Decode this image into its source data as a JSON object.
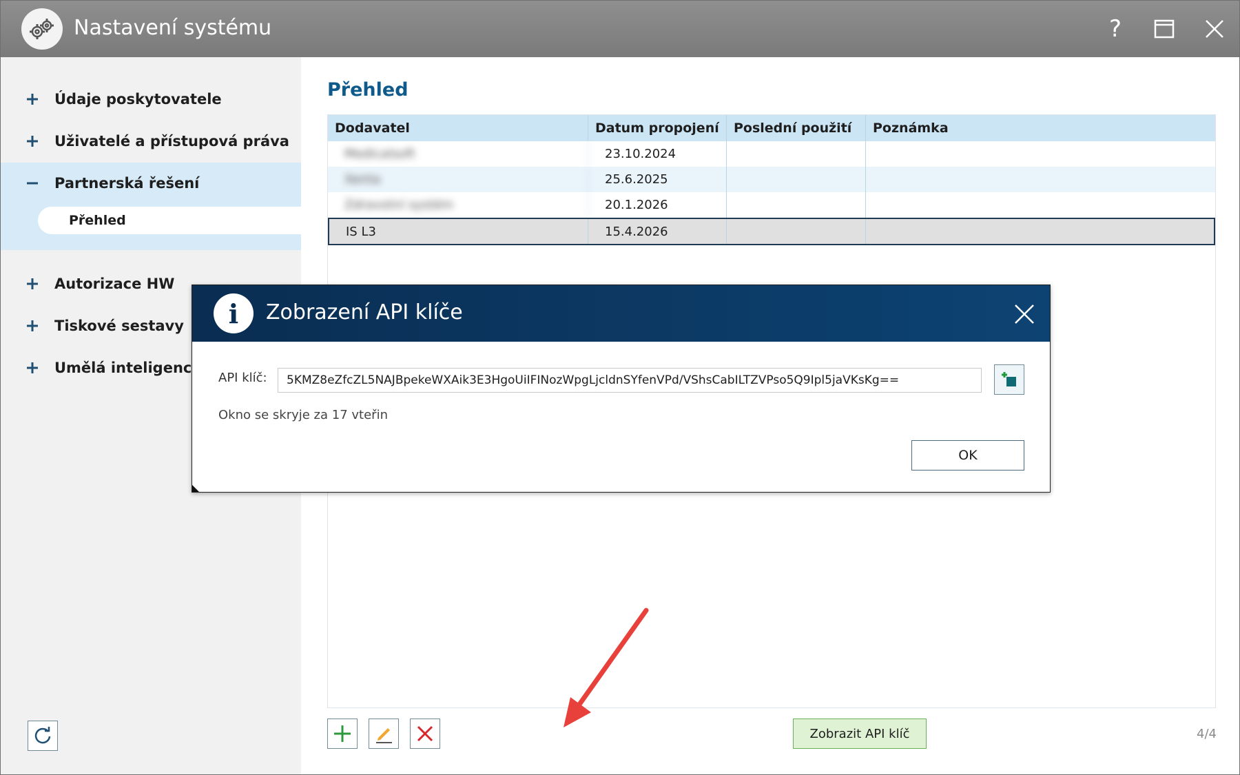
{
  "window": {
    "title": "Nastavení systému",
    "help_label": "?"
  },
  "sidebar": {
    "items": [
      {
        "label": "Údaje poskytovatele"
      },
      {
        "label": "Uživatelé a přístupová práva"
      },
      {
        "label": "Partnerská řešení"
      },
      {
        "label": "Autorizace HW"
      },
      {
        "label": "Tiskové sestavy"
      },
      {
        "label": "Umělá inteligence"
      }
    ],
    "sub_item": {
      "label": "Přehled"
    }
  },
  "main": {
    "title": "Přehled",
    "columns": [
      "Dodavatel",
      "Datum propojení",
      "Poslední použití",
      "Poznámka"
    ],
    "rows": [
      {
        "supplier": "Medicalsoft",
        "date": "23.10.2024",
        "last_used": "",
        "note": ""
      },
      {
        "supplier": "Xenta",
        "date": "25.6.2025",
        "last_used": "",
        "note": ""
      },
      {
        "supplier": "Zdravotní systém",
        "date": "20.1.2026",
        "last_used": "",
        "note": ""
      },
      {
        "supplier": "IS L3",
        "date": "15.4.2026",
        "last_used": "",
        "note": ""
      }
    ],
    "show_key_label": "Zobrazit API klíč",
    "page_count": "4/4"
  },
  "dialog": {
    "title": "Zobrazení API klíče",
    "api_label": "API klíč:",
    "api_key": "5KMZ8eZfcZL5NAJBpekeWXAik3E3HgoUiIFINozWpgLjcldnSYfenVPd/VShsCabILTZVPso5Q9Ipl5jaVKsKg==",
    "countdown": "Okno se skryje za 17 vteřin",
    "ok_label": "OK"
  },
  "colors": {
    "accent": "#0e5a8a",
    "selection": "#d7eaf7",
    "header": "#cce5f5",
    "dialog_header": "#0a2d52",
    "arrow": "#e8413c"
  }
}
